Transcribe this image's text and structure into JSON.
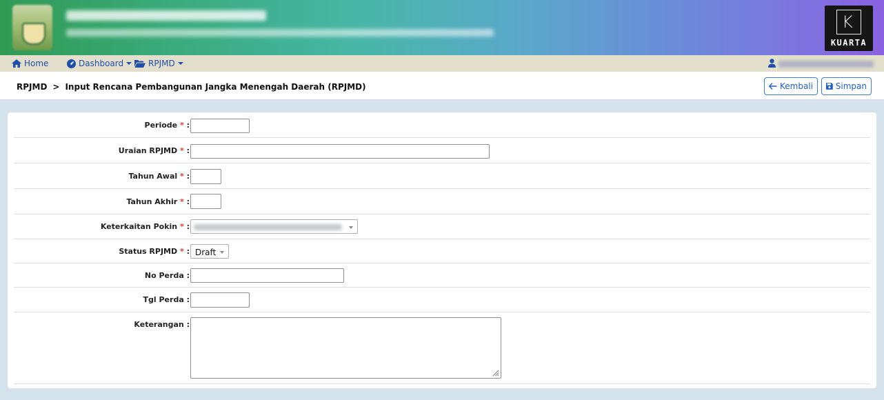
{
  "header": {
    "brand_name": "KUARTA",
    "brand_letter": "K"
  },
  "nav": {
    "home": "Home",
    "dashboard": "Dashboard",
    "rpjmd": "RPJMD"
  },
  "page": {
    "breadcrumb_root": "RPJMD",
    "breadcrumb_sep": ">",
    "breadcrumb_current": "Input Rencana Pembangunan Jangka Menengah Daerah (RPJMD)",
    "back_label": "Kembali",
    "save_label": "Simpan"
  },
  "form": {
    "required_mark": "*",
    "colon": ":",
    "periode_label": "Periode",
    "uraian_label": "Uraian RPJMD",
    "tahun_awal_label": "Tahun Awal",
    "tahun_akhir_label": "Tahun Akhir",
    "keterkaitan_label": "Keterkaitan Pokin",
    "status_label": "Status RPJMD",
    "status_value": "Draft",
    "no_perda_label": "No Perda",
    "tgl_perda_label": "Tgl Perda",
    "keterangan_label": "Keterangan"
  },
  "colors": {
    "accent": "#1f5ed0",
    "required": "#e53935",
    "nav_bg": "#e2dfcc",
    "page_bg": "#d4e2ec"
  },
  "icons": {
    "home": "home-icon",
    "dashboard": "dashboard-icon",
    "folder": "folder-open-icon",
    "user": "user-icon",
    "back": "arrow-left-icon",
    "save": "floppy-disk-icon"
  }
}
